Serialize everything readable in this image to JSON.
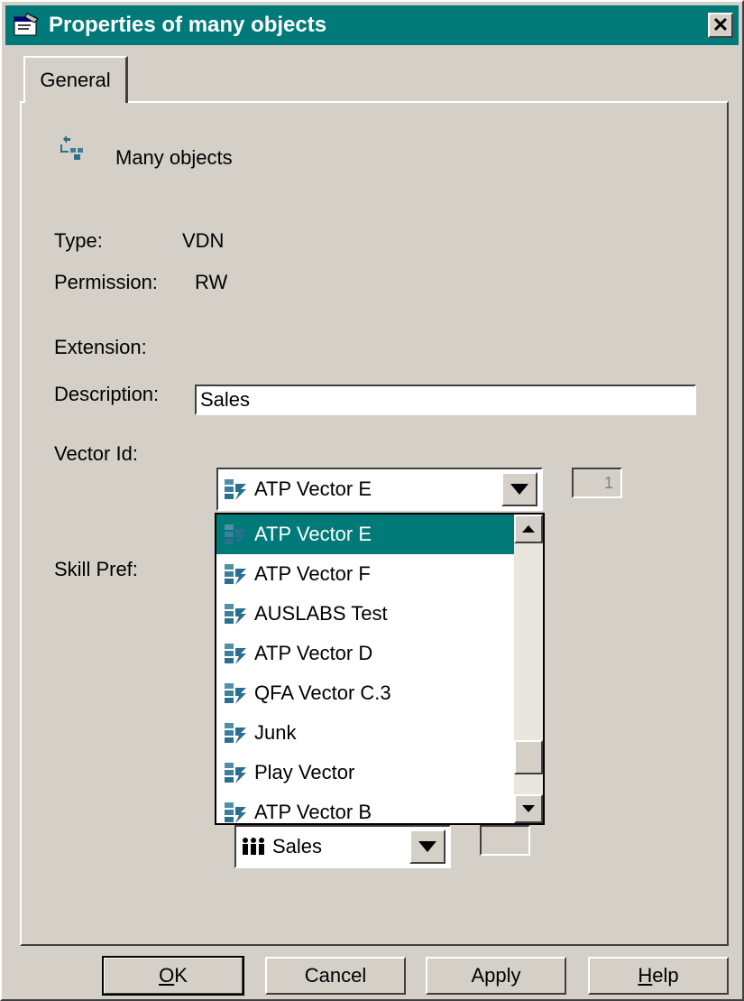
{
  "window": {
    "title": "Properties of many objects",
    "close_glyph": "✕"
  },
  "tabs": [
    {
      "label": "General"
    }
  ],
  "header": {
    "icon": "vdn-multi-icon",
    "name": "Many objects"
  },
  "fields": {
    "type_label": "Type:",
    "type_value": "VDN",
    "permission_label": "Permission:",
    "permission_value": "RW",
    "extension_label": "Extension:",
    "description_label": "Description:",
    "description_value": "Sales",
    "vector_label": "Vector Id:",
    "vector_selected": "ATP Vector E",
    "vector_number": "1",
    "skill_label": "Skill Pref:",
    "skill_selected": "Sales",
    "skill_number": ""
  },
  "vector_options": [
    "ATP Vector E",
    "ATP Vector F",
    "AUSLABS Test",
    "ATP Vector D",
    "QFA Vector C.3",
    "Junk",
    "Play Vector",
    "ATP Vector B"
  ],
  "buttons": {
    "ok_mnemonic": "O",
    "ok_rest": "K",
    "cancel": "Cancel",
    "apply": "Apply",
    "help_mnemonic": "H",
    "help_rest": "elp"
  },
  "colors": {
    "titlebar": "#007a78",
    "face": "#d4d0c8",
    "selection": "#007a78"
  }
}
